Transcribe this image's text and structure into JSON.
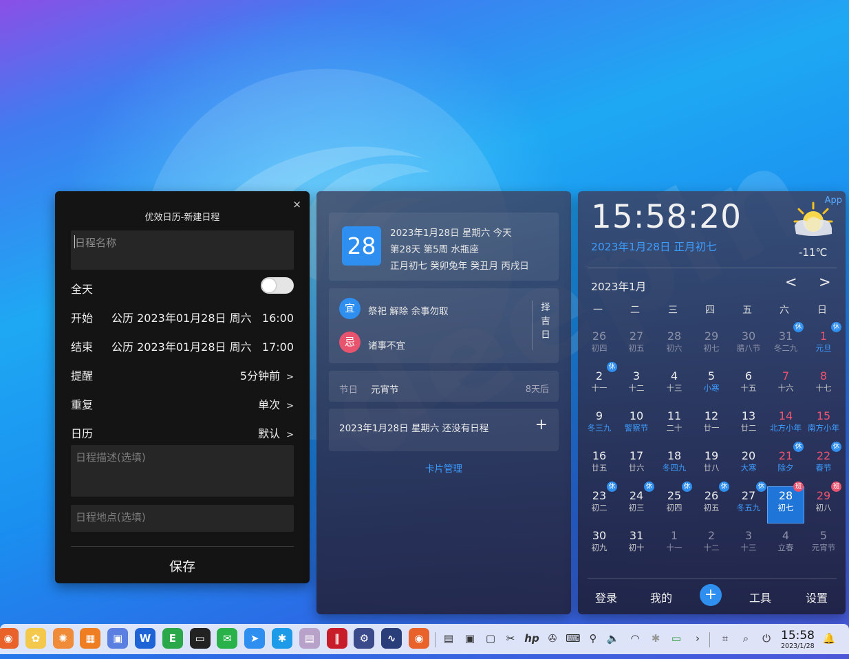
{
  "new_event": {
    "title": "优效日历-新建日程",
    "close": "×",
    "name_placeholder": "日程名称",
    "allday_label": "全天",
    "start_label": "开始",
    "start_value": "公历 2023年01月28日 周六   16:00",
    "end_label": "结束",
    "end_value": "公历 2023年01月28日 周六   17:00",
    "remind_label": "提醒",
    "remind_value": "5分钟前",
    "repeat_label": "重复",
    "repeat_value": "单次",
    "calendar_label": "日历",
    "calendar_value": "默认",
    "chevron": ">",
    "desc_placeholder": "日程描述(选填)",
    "location_placeholder": "日程地点(选填)",
    "save": "保存"
  },
  "info": {
    "day": "28",
    "line1": "2023年1月28日 星期六 今天",
    "line2": "第28天 第5周 水瓶座",
    "line3": "正月初七 癸卯兔年 癸丑月 丙戌日",
    "yi_badge": "宜",
    "yi_text": "祭祀 解除 余事勿取",
    "ji_badge": "忌",
    "ji_text": "诸事不宜",
    "zeji": [
      "择",
      "吉",
      "日"
    ],
    "festival_label": "节日",
    "festival_name": "元宵节",
    "festival_days": "8天后",
    "schedule_text": "2023年1月28日 星期六 还没有日程",
    "add": "+",
    "card_manage": "卡片管理"
  },
  "calendar": {
    "app": "App",
    "time": "15:58:20",
    "date": "2023年1月28日 正月初七",
    "temp": "-11℃",
    "month": "2023年1月",
    "prev": "<",
    "next": ">",
    "weekdays": [
      "一",
      "二",
      "三",
      "四",
      "五",
      "六",
      "日"
    ],
    "weeks": [
      [
        {
          "n": "26",
          "l": "初四",
          "dim": true
        },
        {
          "n": "27",
          "l": "初五",
          "dim": true
        },
        {
          "n": "28",
          "l": "初六",
          "dim": true
        },
        {
          "n": "29",
          "l": "初七",
          "dim": true
        },
        {
          "n": "30",
          "l": "腊八节",
          "dim": true
        },
        {
          "n": "31",
          "l": "冬二九",
          "dim": true,
          "tag": "休"
        },
        {
          "n": "1",
          "l": "元旦",
          "red": true,
          "fest": true,
          "tag": "休"
        }
      ],
      [
        {
          "n": "2",
          "l": "十一",
          "tag": "休"
        },
        {
          "n": "3",
          "l": "十二"
        },
        {
          "n": "4",
          "l": "十三"
        },
        {
          "n": "5",
          "l": "小寒",
          "fest": true
        },
        {
          "n": "6",
          "l": "十五"
        },
        {
          "n": "7",
          "l": "十六",
          "red": true
        },
        {
          "n": "8",
          "l": "十七",
          "red": true
        }
      ],
      [
        {
          "n": "9",
          "l": "冬三九",
          "fest": true
        },
        {
          "n": "10",
          "l": "警察节",
          "fest": true
        },
        {
          "n": "11",
          "l": "二十"
        },
        {
          "n": "12",
          "l": "廿一"
        },
        {
          "n": "13",
          "l": "廿二"
        },
        {
          "n": "14",
          "l": "北方小年",
          "red": true,
          "fest": true
        },
        {
          "n": "15",
          "l": "南方小年",
          "red": true,
          "fest": true
        }
      ],
      [
        {
          "n": "16",
          "l": "廿五"
        },
        {
          "n": "17",
          "l": "廿六"
        },
        {
          "n": "18",
          "l": "冬四九",
          "fest": true
        },
        {
          "n": "19",
          "l": "廿八"
        },
        {
          "n": "20",
          "l": "大寒",
          "fest": true
        },
        {
          "n": "21",
          "l": "除夕",
          "red": true,
          "fest": true,
          "tag": "休"
        },
        {
          "n": "22",
          "l": "春节",
          "red": true,
          "fest": true,
          "tag": "休"
        }
      ],
      [
        {
          "n": "23",
          "l": "初二",
          "tag": "休"
        },
        {
          "n": "24",
          "l": "初三",
          "tag": "休"
        },
        {
          "n": "25",
          "l": "初四",
          "tag": "休"
        },
        {
          "n": "26",
          "l": "初五",
          "tag": "休"
        },
        {
          "n": "27",
          "l": "冬五九",
          "fest": true,
          "tag": "休"
        },
        {
          "n": "28",
          "l": "初七",
          "sel": true,
          "tag": "班"
        },
        {
          "n": "29",
          "l": "初八",
          "red": true,
          "tag": "班"
        }
      ],
      [
        {
          "n": "30",
          "l": "初九"
        },
        {
          "n": "31",
          "l": "初十"
        },
        {
          "n": "1",
          "l": "十一",
          "dim": true
        },
        {
          "n": "2",
          "l": "十二",
          "dim": true
        },
        {
          "n": "3",
          "l": "十三",
          "dim": true
        },
        {
          "n": "4",
          "l": "立春",
          "dim": true
        },
        {
          "n": "5",
          "l": "元宵节",
          "dim": true
        }
      ]
    ],
    "footer": {
      "login": "登录",
      "mine": "我的",
      "add": "+",
      "tools": "工具",
      "settings": "设置"
    }
  },
  "taskbar": {
    "time": "15:58",
    "date": "2023/1/28",
    "apps": [
      {
        "name": "firefox-icon",
        "color": "#e8622a",
        "glyph": "◉"
      },
      {
        "name": "calendar-app-icon",
        "color": "#f3c84b",
        "glyph": "✿"
      },
      {
        "name": "pinwheel-icon",
        "color": "#f08b3a",
        "glyph": "✺"
      },
      {
        "name": "store-icon",
        "color": "#ef7d22",
        "glyph": "▦"
      },
      {
        "name": "launcher-grid-icon",
        "color": "#5b7fe0",
        "glyph": "▣"
      },
      {
        "name": "wps-icon",
        "color": "#1e64d6",
        "glyph": "W"
      },
      {
        "name": "evernote-icon",
        "color": "#2aa84a",
        "glyph": "E"
      },
      {
        "name": "terminal-icon",
        "color": "#222222",
        "glyph": "▭"
      },
      {
        "name": "wechat-icon",
        "color": "#2ab24a",
        "glyph": "✉"
      },
      {
        "name": "feishu-icon",
        "color": "#2f8ff0",
        "glyph": "➤"
      },
      {
        "name": "star-app-icon",
        "color": "#1e9be8",
        "glyph": "✱"
      },
      {
        "name": "clipboard-icon",
        "color": "#b9a2c9",
        "glyph": "▤"
      },
      {
        "name": "deepin-red-icon",
        "color": "#c81c2a",
        "glyph": "‖"
      },
      {
        "name": "settings-gear-icon",
        "color": "#3a4a8a",
        "glyph": "⚙"
      },
      {
        "name": "system-monitor-icon",
        "color": "#2a3f7a",
        "glyph": "∿"
      },
      {
        "name": "firefox-2-icon",
        "color": "#e8622a",
        "glyph": "◉"
      }
    ]
  }
}
